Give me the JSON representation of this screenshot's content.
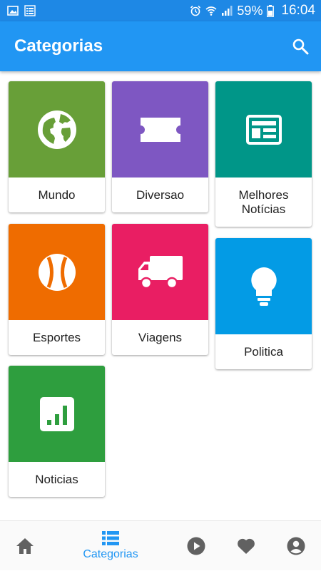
{
  "status_bar": {
    "battery": "59%",
    "time": "16:04",
    "icons": [
      "image-icon",
      "list-icon",
      "alarm-icon",
      "wifi-icon",
      "signal-icon",
      "battery-icon"
    ]
  },
  "app_bar": {
    "title": "Categorias",
    "search_icon": "search-icon"
  },
  "categories": [
    {
      "label": "Mundo",
      "icon": "globe-icon",
      "color": "#689f38"
    },
    {
      "label": "Diversao",
      "icon": "ticket-icon",
      "color": "#7e57c2"
    },
    {
      "label": "Melhores Notícias",
      "label_line1": "Melhores",
      "label_line2": "Notícias",
      "icon": "newspaper-icon",
      "color": "#009688"
    },
    {
      "label": "Esportes",
      "icon": "ball-icon",
      "color": "#ef6c00"
    },
    {
      "label": "Viagens",
      "icon": "truck-icon",
      "color": "#e91e63"
    },
    {
      "label": "Politica",
      "icon": "lightbulb-icon",
      "color": "#039be5"
    },
    {
      "label": "Noticias",
      "icon": "chart-icon",
      "color": "#2e9e3e"
    }
  ],
  "bottom_nav": {
    "items": [
      {
        "name": "home",
        "icon": "home-icon",
        "label": ""
      },
      {
        "name": "categorias",
        "icon": "categories-icon",
        "label": "Categorias",
        "active": true
      },
      {
        "name": "play",
        "icon": "play-icon",
        "label": ""
      },
      {
        "name": "favorites",
        "icon": "heart-icon",
        "label": ""
      },
      {
        "name": "account",
        "icon": "account-icon",
        "label": ""
      }
    ],
    "active_color": "#2196f3",
    "inactive_color": "#616161"
  }
}
